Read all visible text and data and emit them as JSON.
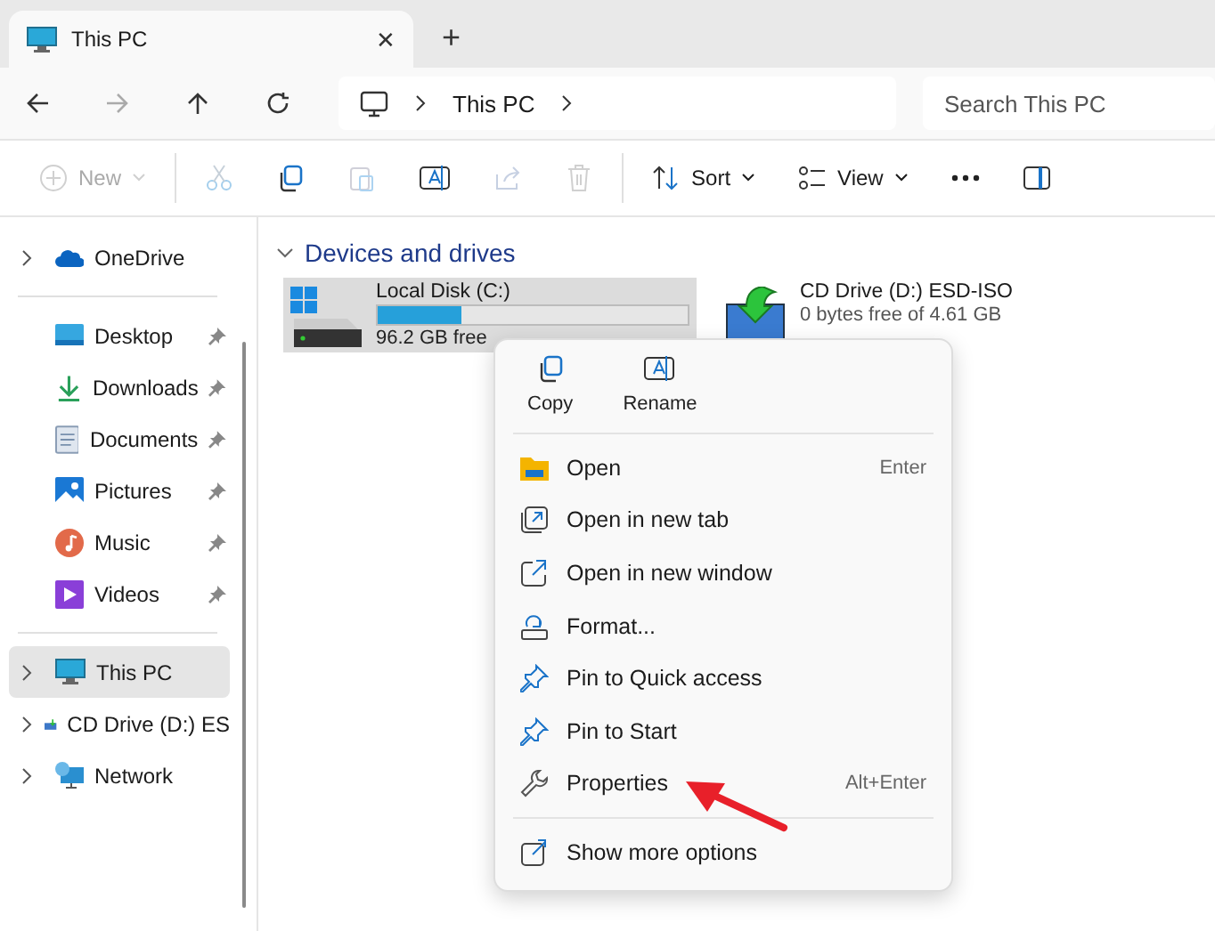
{
  "tab": {
    "title": "This PC",
    "selected": true,
    "close": "✕",
    "new": "+"
  },
  "address": {
    "crumbs": [
      "This PC"
    ],
    "search": {
      "placeholder": "Search This PC"
    }
  },
  "toolbar": {
    "items": [
      {
        "kind": "dropdown",
        "label": "New",
        "disabled": true
      },
      {
        "kind": "icon",
        "disabled": true
      },
      {
        "kind": "icon",
        "disabled": false
      },
      {
        "kind": "icon",
        "disabled": true
      },
      {
        "kind": "icon",
        "disabled": false
      },
      {
        "kind": "icon",
        "disabled": true
      },
      {
        "kind": "icon",
        "disabled": true
      },
      {
        "kind": "dropdown",
        "label": "Sort",
        "disabled": false
      },
      {
        "kind": "dropdown",
        "label": "View",
        "disabled": false
      },
      {
        "kind": "more",
        "disabled": false
      },
      {
        "kind": "icon",
        "disabled": false
      }
    ]
  },
  "sidebar": {
    "groups": [
      [
        {
          "label": "OneDrive",
          "expandable": true,
          "pinned": false,
          "selected": false
        }
      ],
      [
        {
          "label": "Desktop",
          "expandable": false,
          "pinned": true,
          "selected": false
        },
        {
          "label": "Downloads",
          "expandable": false,
          "pinned": true,
          "selected": false
        },
        {
          "label": "Documents",
          "expandable": false,
          "pinned": true,
          "selected": false
        },
        {
          "label": "Pictures",
          "expandable": false,
          "pinned": true,
          "selected": false
        },
        {
          "label": "Music",
          "expandable": false,
          "pinned": true,
          "selected": false
        },
        {
          "label": "Videos",
          "expandable": false,
          "pinned": true,
          "selected": false
        }
      ],
      [
        {
          "label": "This PC",
          "expandable": true,
          "pinned": false,
          "selected": true
        },
        {
          "label": "CD Drive (D:) ES",
          "expandable": true,
          "pinned": false,
          "selected": false
        },
        {
          "label": "Network",
          "expandable": true,
          "pinned": false,
          "selected": false
        }
      ]
    ]
  },
  "section": {
    "title": "Devices and drives",
    "expanded": true
  },
  "drives": [
    {
      "name": "Local Disk (C:)",
      "free": "96.2 GB free",
      "level": 0.27,
      "selected": true
    },
    {
      "name": "CD Drive (D:) ESD-ISO",
      "free": "0 bytes free of 4.61 GB",
      "selected": false
    }
  ],
  "context_menu": {
    "quick_actions": [
      {
        "label": "Copy"
      },
      {
        "label": "Rename"
      }
    ],
    "sections": [
      [
        {
          "label": "Open",
          "shortcut": "Enter"
        },
        {
          "label": "Open in new tab"
        },
        {
          "label": "Open in new window"
        },
        {
          "label": "Format..."
        },
        {
          "label": "Pin to Quick access"
        },
        {
          "label": "Pin to Start"
        },
        {
          "label": "Properties",
          "shortcut": "Alt+Enter"
        }
      ],
      [
        {
          "label": "Show more options"
        }
      ]
    ]
  }
}
